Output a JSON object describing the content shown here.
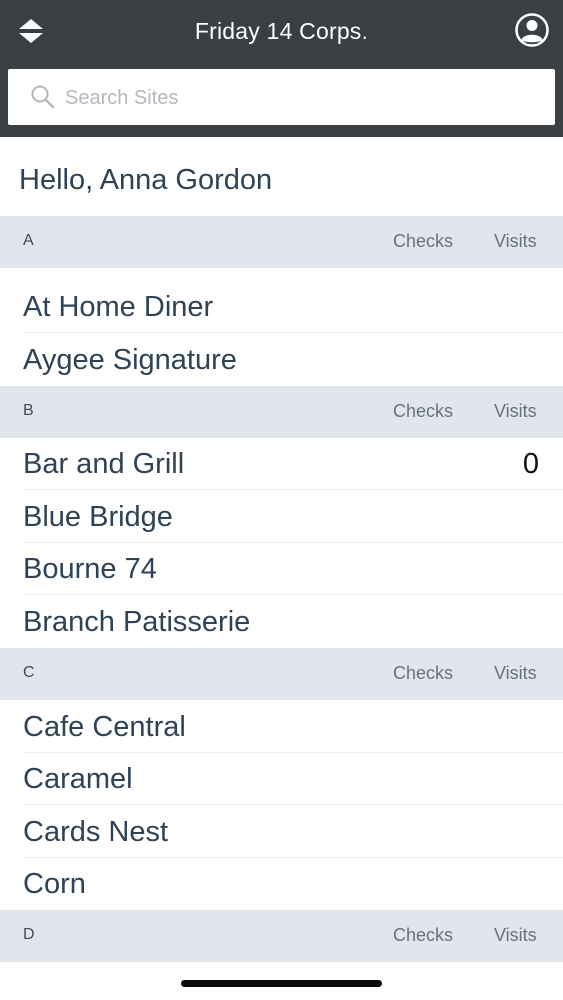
{
  "header": {
    "title": "Friday 14 Corps.",
    "sort_icon": "sort-updown-icon",
    "profile_icon": "user-circle-icon"
  },
  "search": {
    "placeholder": "Search Sites",
    "value": ""
  },
  "greeting": "Hello, Anna Gordon",
  "columns": {
    "checks": "Checks",
    "visits": "Visits"
  },
  "sections": [
    {
      "letter": "A",
      "items": [
        {
          "name": "At Home Diner",
          "count": ""
        },
        {
          "name": "Aygee Signature",
          "count": ""
        }
      ]
    },
    {
      "letter": "B",
      "items": [
        {
          "name": "Bar and Grill",
          "count": "0"
        },
        {
          "name": "Blue Bridge",
          "count": ""
        },
        {
          "name": "Bourne 74",
          "count": ""
        },
        {
          "name": "Branch Patisserie",
          "count": ""
        }
      ]
    },
    {
      "letter": "C",
      "items": [
        {
          "name": "Cafe Central",
          "count": ""
        },
        {
          "name": "Caramel",
          "count": ""
        },
        {
          "name": "Cards Nest",
          "count": ""
        },
        {
          "name": "Corn",
          "count": ""
        }
      ]
    },
    {
      "letter": "D",
      "items": []
    }
  ],
  "colors": {
    "topbar": "#3a3f43",
    "section_bg": "#e2e6ec",
    "text_primary": "#2f4256"
  }
}
